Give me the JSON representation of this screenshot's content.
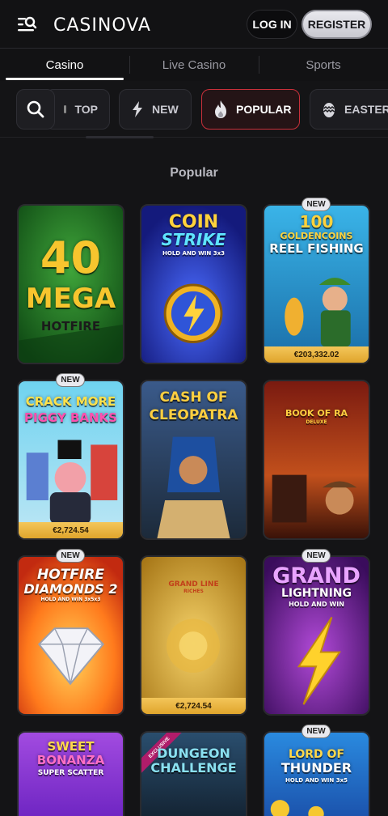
{
  "header": {
    "logo": "CASINOVA",
    "login_label": "LOG IN",
    "register_label": "REGISTER"
  },
  "tabs": [
    {
      "label": "Casino",
      "active": true
    },
    {
      "label": "Live Casino",
      "active": false
    },
    {
      "label": "Sports",
      "active": false
    }
  ],
  "categories": [
    {
      "label": "TOP",
      "icon": "top-icon"
    },
    {
      "label": "NEW",
      "icon": "lightning-icon"
    },
    {
      "label": "POPULAR",
      "icon": "flame-icon",
      "active": true
    },
    {
      "label": "EASTER",
      "icon": "easter-egg-icon"
    }
  ],
  "section_title": "Popular",
  "badge_new": "NEW",
  "games": [
    {
      "title_line1": "40",
      "title_line2": "MEGA",
      "title_line3": "HOTFIRE"
    },
    {
      "title_line1": "COIN",
      "title_line2": "STRIKE",
      "title_line3": "HOLD AND WIN 3x3"
    },
    {
      "title_line1": "100",
      "title_line2": "GOLDENCOINS",
      "title_line3": "REEL FISHING",
      "price": "€203,332.02",
      "new": true
    },
    {
      "title_line1": "CRACK MORE",
      "title_line2": "PIGGY BANKS",
      "price": "€2,724.54",
      "new": true
    },
    {
      "title_line1": "CASH OF",
      "title_line2": "CLEOPATRA"
    },
    {
      "title_line1": "BOOK OF RA",
      "title_line2": "DELUXE"
    },
    {
      "title_line1": "HOTFIRE",
      "title_line2": "DIAMONDS 2",
      "title_line3": "HOLD AND WIN 3x5x3",
      "new": true
    },
    {
      "title_line1": "GRAND LINE",
      "title_line2": "RICHES",
      "price": "€2,724.54"
    },
    {
      "title_line1": "GRAND",
      "title_line2": "LIGHTNING",
      "title_line3": "HOLD AND WIN",
      "new": true
    },
    {
      "title_line1": "SWEET",
      "title_line2": "BONANZA",
      "title_line3": "SUPER SCATTER"
    },
    {
      "title_line1": "DUNGEON",
      "title_line2": "CHALLENGE",
      "ribbon": "EXCLUSIVE"
    },
    {
      "title_line1": "LORD OF",
      "title_line2": "THUNDER",
      "title_line3": "HOLD AND WIN 3x5",
      "new": true
    }
  ],
  "colors": {
    "background": "#141416",
    "accent_red": "#c8303a",
    "gold": "#f3c65a"
  }
}
